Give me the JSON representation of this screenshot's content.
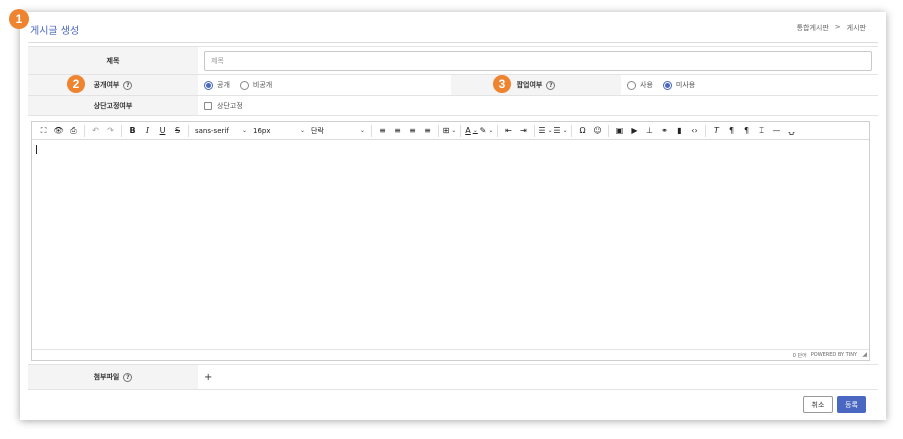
{
  "markers": [
    "1",
    "2",
    "3"
  ],
  "header": {
    "title": "게시글 생성",
    "breadcrumb": [
      "통합게시판",
      ">",
      "게시판"
    ]
  },
  "form": {
    "title_label": "제목",
    "title_placeholder": "제목",
    "public_label": "공개여부",
    "public_options": [
      "공개",
      "비공개"
    ],
    "popup_label": "팝업여부",
    "popup_options": [
      "사용",
      "미사용"
    ],
    "pin_label": "상단고정여부",
    "pin_option": "상단고정",
    "help_glyph": "?"
  },
  "editor": {
    "font_family": "sans-serif",
    "font_size": "16px",
    "block_format": "단락",
    "status": [
      "0 단어",
      "POWERED BY TINY"
    ]
  },
  "attachment": {
    "label": "첨부파일",
    "add_glyph": "+"
  },
  "buttons": {
    "cancel": "취소",
    "submit": "등록"
  },
  "colors": {
    "accent": "#4a67c2",
    "marker": "#ee8330"
  }
}
